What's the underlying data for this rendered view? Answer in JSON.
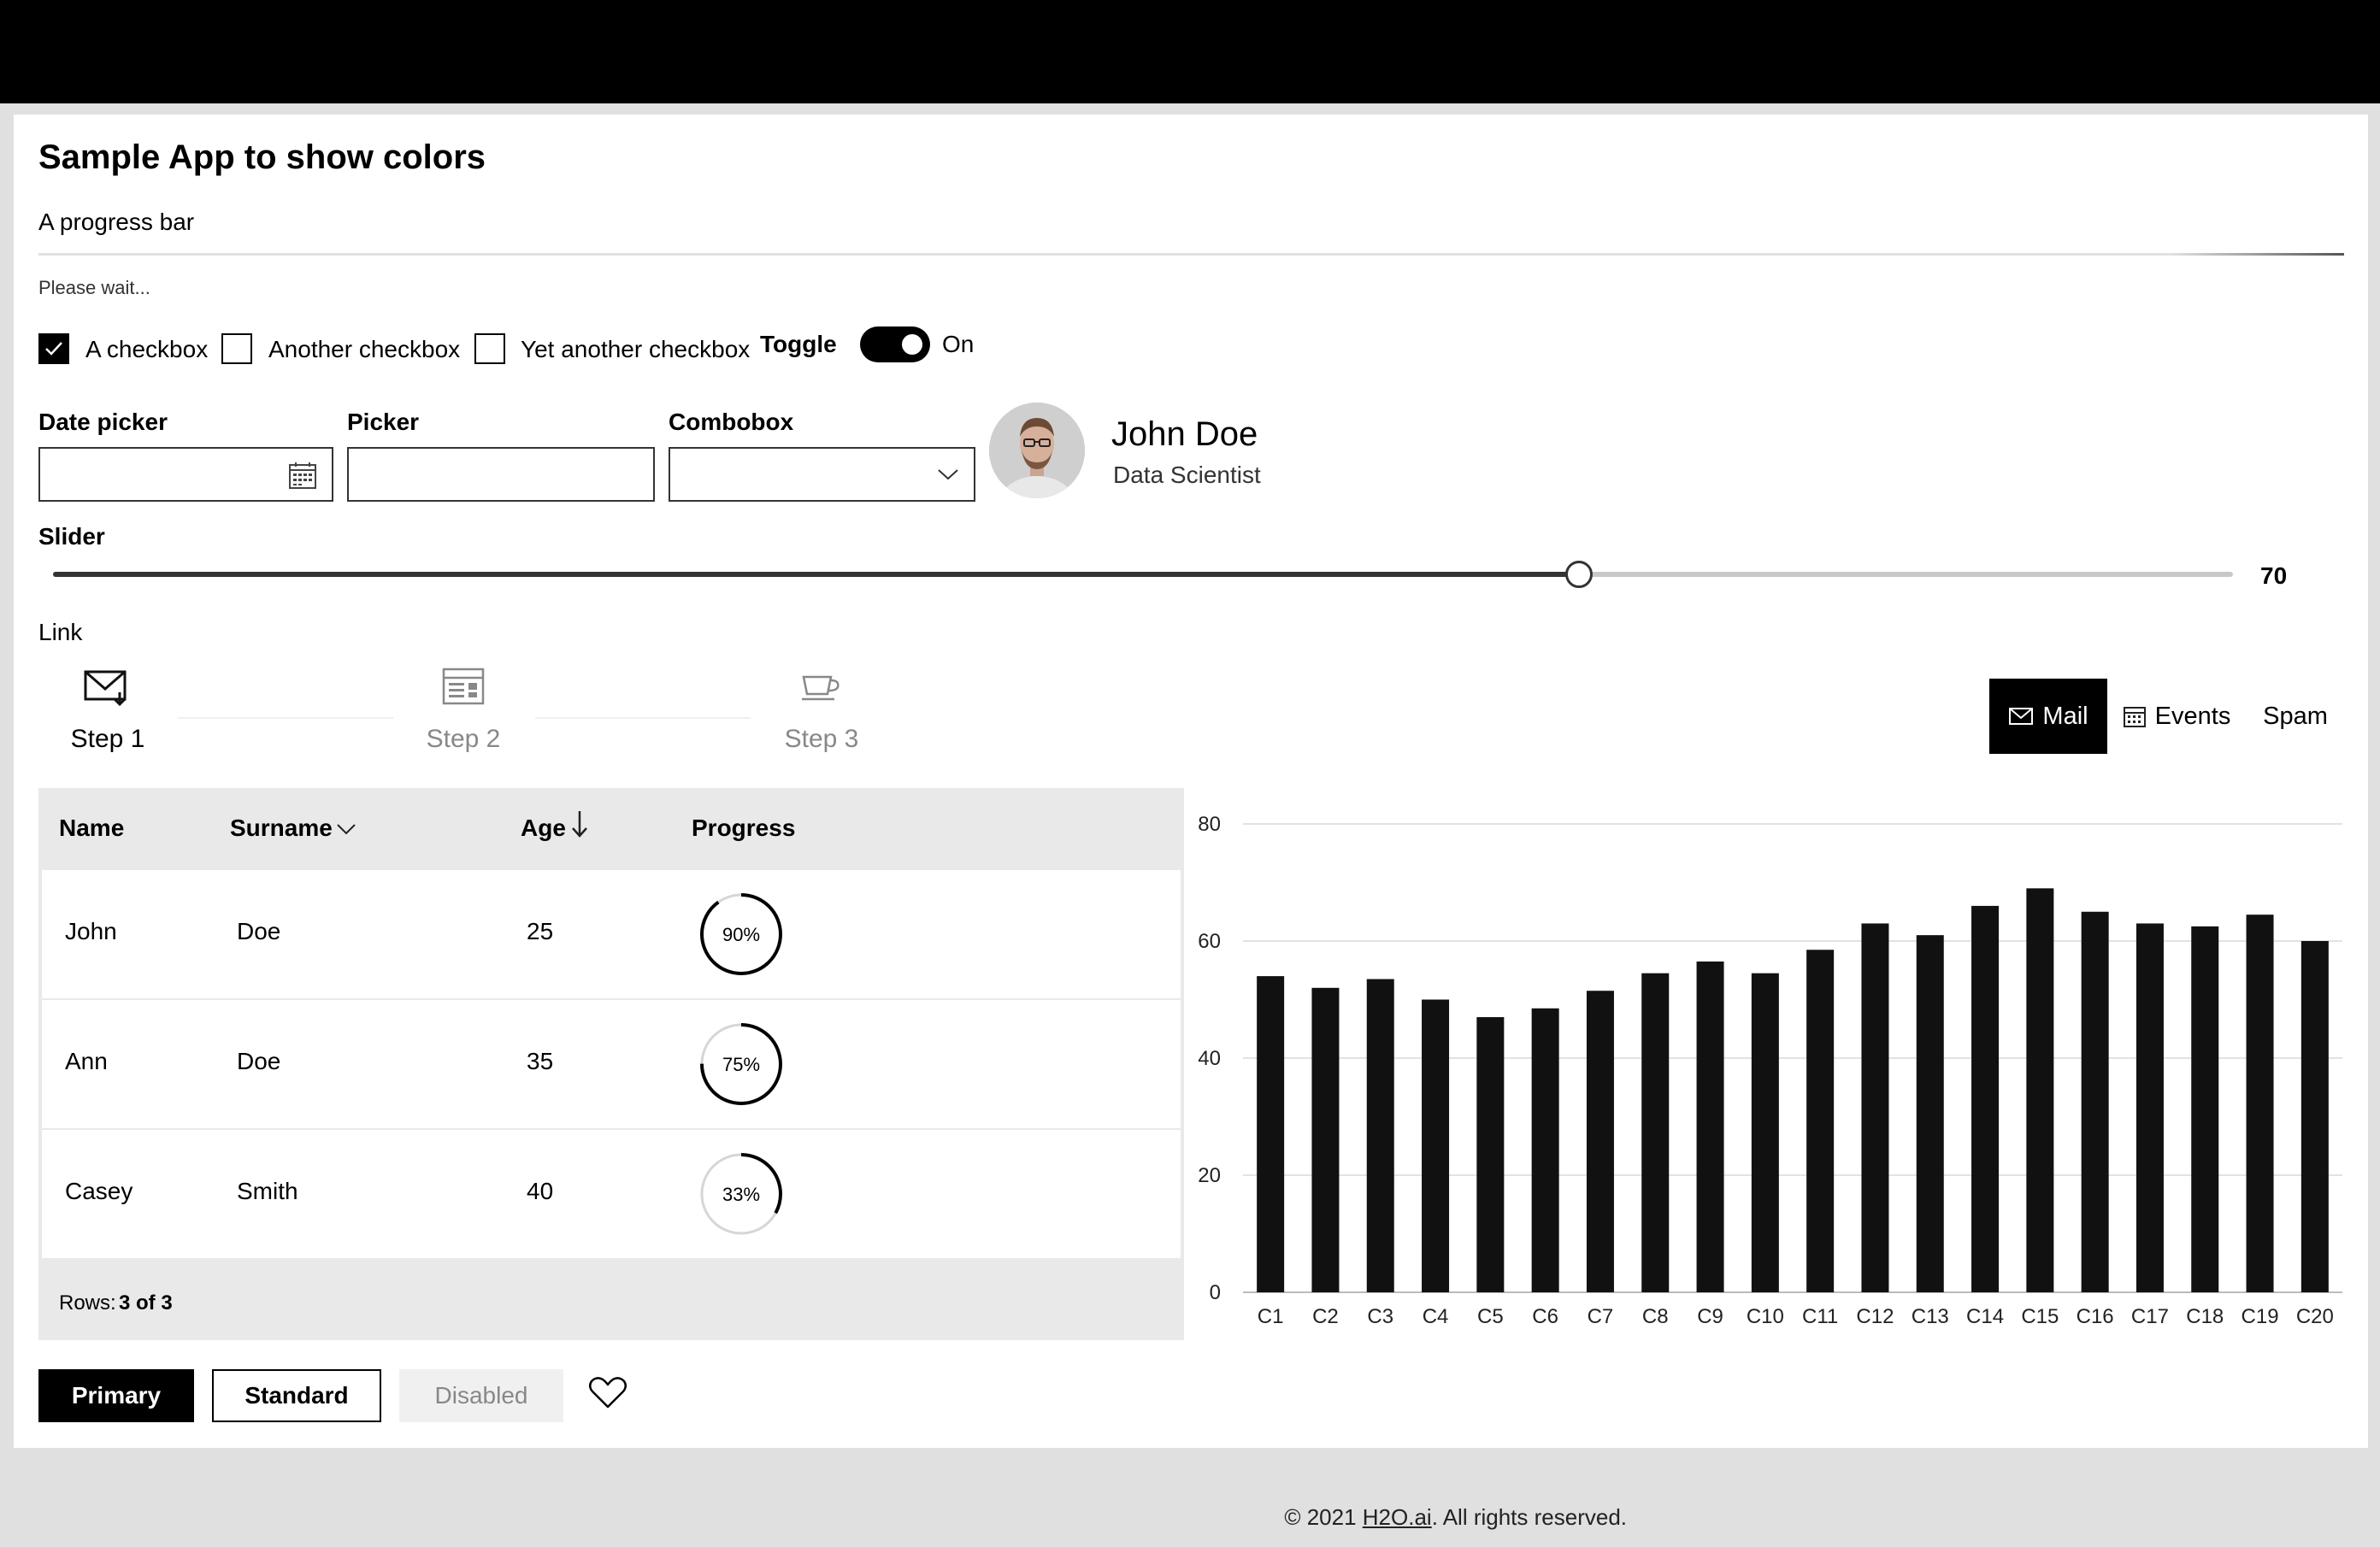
{
  "app": {
    "title": "Sample App to show colors",
    "progress_label": "A progress bar",
    "progress_caption": "Please wait..."
  },
  "checkboxes": [
    {
      "label": "A checkbox",
      "checked": true
    },
    {
      "label": "Another checkbox",
      "checked": false
    },
    {
      "label": "Yet another checkbox",
      "checked": false
    }
  ],
  "toggle": {
    "label": "Toggle",
    "state_text": "On",
    "on": true
  },
  "fields": {
    "date_picker": {
      "label": "Date picker",
      "value": ""
    },
    "picker": {
      "label": "Picker",
      "value": ""
    },
    "combobox": {
      "label": "Combobox",
      "value": ""
    }
  },
  "persona": {
    "name": "John Doe",
    "role": "Data Scientist"
  },
  "slider": {
    "label": "Slider",
    "value": 70,
    "min": 0,
    "max": 100,
    "value_text": "70"
  },
  "link": {
    "label": "Link"
  },
  "stepper": {
    "steps": [
      {
        "label": "Step 1",
        "icon": "mail-icon",
        "active": true
      },
      {
        "label": "Step 2",
        "icon": "calendar-grid-icon",
        "active": false
      },
      {
        "label": "Step 3",
        "icon": "coffee-cup-icon",
        "active": false
      }
    ]
  },
  "tabs": [
    {
      "label": "Mail",
      "icon": "mail-icon",
      "active": true
    },
    {
      "label": "Events",
      "icon": "calendar-icon",
      "active": false
    },
    {
      "label": "Spam",
      "active": false
    }
  ],
  "table": {
    "columns": [
      "Name",
      "Surname",
      "Age",
      "Progress"
    ],
    "rows": [
      {
        "name": "John",
        "surname": "Doe",
        "age": "25",
        "progress": 0.9,
        "progress_text": "90%"
      },
      {
        "name": "Ann",
        "surname": "Doe",
        "age": "35",
        "progress": 0.75,
        "progress_text": "75%"
      },
      {
        "name": "Casey",
        "surname": "Smith",
        "age": "40",
        "progress": 0.33,
        "progress_text": "33%"
      }
    ],
    "footer_label": "Rows:",
    "footer_value": "3 of 3"
  },
  "chart_data": {
    "type": "bar",
    "categories": [
      "C1",
      "C2",
      "C3",
      "C4",
      "C5",
      "C6",
      "C7",
      "C8",
      "C9",
      "C10",
      "C11",
      "C12",
      "C13",
      "C14",
      "C15",
      "C16",
      "C17",
      "C18",
      "C19",
      "C20"
    ],
    "values": [
      54,
      52,
      53.5,
      50,
      47,
      48.5,
      51.5,
      54.5,
      56.5,
      54.5,
      58.5,
      63,
      61,
      66,
      69,
      65,
      63,
      62.5,
      64.5,
      60
    ],
    "ylim": [
      0,
      80
    ],
    "yticks": [
      0,
      20,
      40,
      60,
      80
    ],
    "grid": true,
    "bar_color": "#111111"
  },
  "buttons": {
    "primary": "Primary",
    "standard": "Standard",
    "disabled": "Disabled"
  },
  "footer": {
    "prefix": "© 2021 ",
    "brand": "H2O.ai",
    "suffix": ". All rights reserved."
  },
  "colors": {
    "accent": "#000000",
    "track": "#c8c8c8",
    "grid_bg": "#e9e9e9"
  }
}
